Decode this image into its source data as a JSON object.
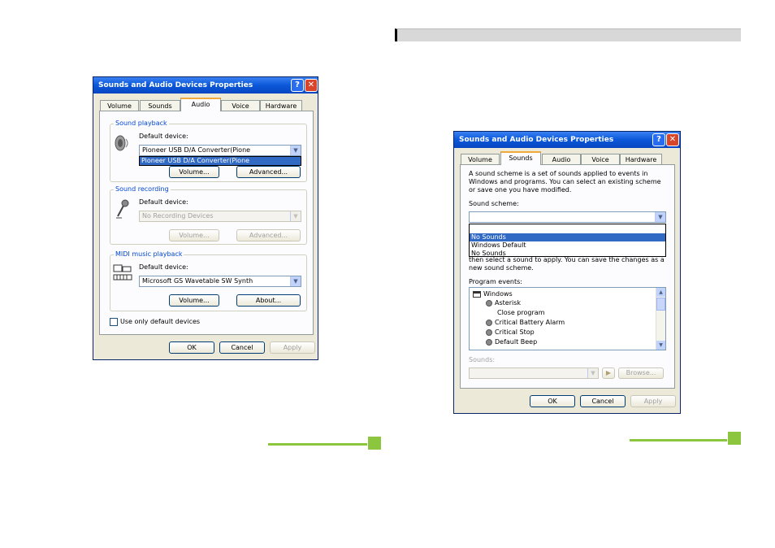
{
  "left_dialog": {
    "title": "Sounds and Audio Devices Properties",
    "tabs": [
      "Volume",
      "Sounds",
      "Audio",
      "Voice",
      "Hardware"
    ],
    "active_tab": "Audio",
    "playback": {
      "group_label": "Sound playback",
      "device_label": "Default device:",
      "device_value": "Pioneer USB D/A Converter(Pione",
      "dropdown_item": "Pioneer USB D/A Converter(Pione",
      "volume_button": "Volume...",
      "advanced_button": "Advanced..."
    },
    "recording": {
      "group_label": "Sound recording",
      "device_label": "Default device:",
      "device_value": "No Recording Devices",
      "volume_button": "Volume...",
      "advanced_button": "Advanced..."
    },
    "midi": {
      "group_label": "MIDI music playback",
      "device_label": "Default device:",
      "device_value": "Microsoft GS Wavetable SW Synth",
      "volume_button": "Volume...",
      "about_button": "About..."
    },
    "default_only_label": "Use only default devices",
    "ok": "OK",
    "cancel": "Cancel",
    "apply": "Apply"
  },
  "right_dialog": {
    "title": "Sounds and Audio Devices Properties",
    "tabs": [
      "Volume",
      "Sounds",
      "Audio",
      "Voice",
      "Hardware"
    ],
    "active_tab": "Sounds",
    "description": "A sound scheme is a set of sounds applied to events in Windows and programs. You can select an existing scheme or save one you have modified.",
    "scheme_label": "Sound scheme:",
    "scheme_value": "",
    "scheme_options": [
      "No Sounds",
      "Windows Default",
      "No Sounds"
    ],
    "partial_text": "then select a sound to apply. You can save the changes as a new sound scheme.",
    "program_events_label": "Program events:",
    "events": [
      {
        "name": "Windows",
        "level": 0,
        "has_sound": false
      },
      {
        "name": "Asterisk",
        "level": 1,
        "has_sound": true
      },
      {
        "name": "Close program",
        "level": 1,
        "has_sound": false
      },
      {
        "name": "Critical Battery Alarm",
        "level": 1,
        "has_sound": true
      },
      {
        "name": "Critical Stop",
        "level": 1,
        "has_sound": true
      },
      {
        "name": "Default Beep",
        "level": 1,
        "has_sound": true
      }
    ],
    "sounds_label": "Sounds:",
    "sounds_value": "",
    "play_icon": "play-icon",
    "browse": "Browse...",
    "ok": "OK",
    "cancel": "Cancel",
    "apply": "Apply"
  },
  "colors": {
    "accent_green": "#8cc63f",
    "title_blue": "#0a57d8",
    "selection_blue": "#316ac5"
  }
}
